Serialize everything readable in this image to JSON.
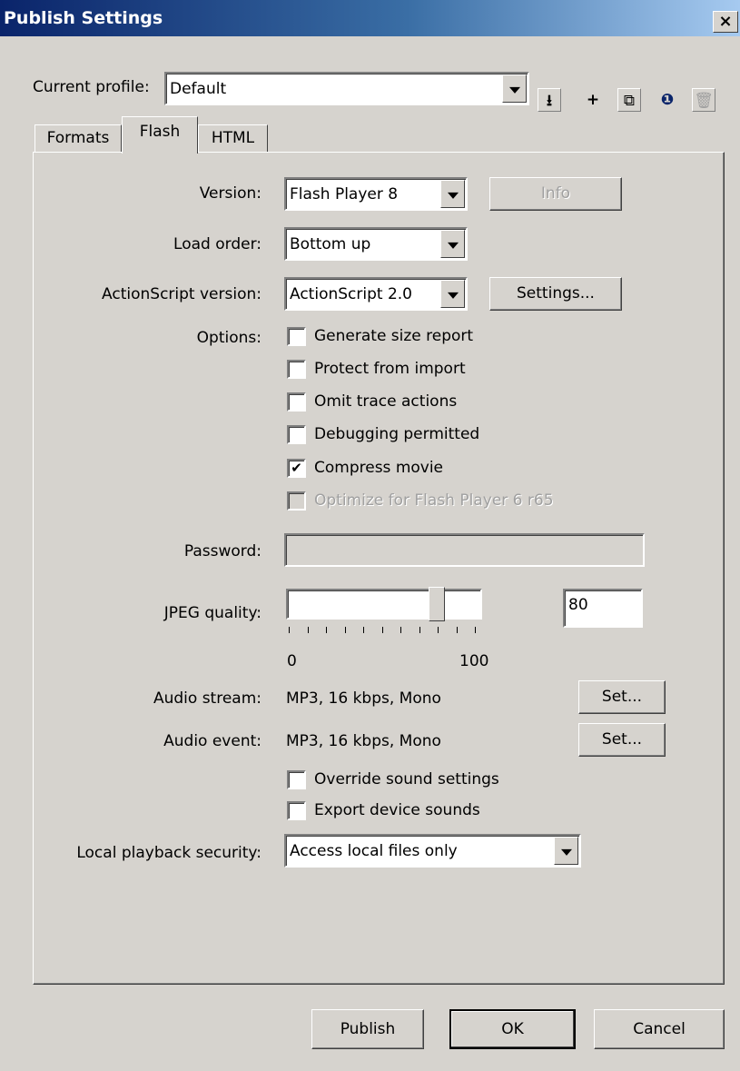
{
  "window": {
    "title": "Publish Settings",
    "close_glyph": "×"
  },
  "profile": {
    "label": "Current profile:",
    "value": "Default",
    "tools": [
      {
        "icon": "import-export-icon",
        "glyph": "⭳"
      },
      {
        "icon": "add-icon",
        "glyph": "+"
      },
      {
        "icon": "duplicate-icon",
        "glyph": "⧉"
      },
      {
        "icon": "info-icon",
        "glyph": "❶"
      },
      {
        "icon": "delete-icon",
        "glyph": "🗑"
      }
    ]
  },
  "tabs": [
    {
      "label": "Formats",
      "active": false
    },
    {
      "label": "Flash",
      "active": true
    },
    {
      "label": "HTML",
      "active": false
    }
  ],
  "flash": {
    "version": {
      "label": "Version:",
      "value": "Flash Player 8",
      "info_button": "Info"
    },
    "load_order": {
      "label": "Load order:",
      "value": "Bottom up"
    },
    "actionscript": {
      "label": "ActionScript version:",
      "value": "ActionScript 2.0",
      "settings_button": "Settings..."
    },
    "options": {
      "label": "Options:",
      "items": [
        {
          "label": "Generate size report",
          "checked": false,
          "enabled": true
        },
        {
          "label": "Protect from import",
          "checked": false,
          "enabled": true
        },
        {
          "label": "Omit trace actions",
          "checked": false,
          "enabled": true
        },
        {
          "label": "Debugging permitted",
          "checked": false,
          "enabled": true
        },
        {
          "label": "Compress movie",
          "checked": true,
          "enabled": true
        },
        {
          "label": "Optimize for Flash Player 6 r65",
          "checked": false,
          "enabled": false
        }
      ]
    },
    "password": {
      "label": "Password:",
      "value": ""
    },
    "jpeg": {
      "label": "JPEG quality:",
      "value": "80",
      "min_label": "0",
      "max_label": "100",
      "level": 80
    },
    "audio_stream": {
      "label": "Audio stream:",
      "value": "MP3, 16 kbps, Mono",
      "button": "Set..."
    },
    "audio_event": {
      "label": "Audio event:",
      "value": "MP3, 16 kbps, Mono",
      "button": "Set..."
    },
    "sound_options": [
      {
        "label": "Override sound settings",
        "checked": false
      },
      {
        "label": "Export device sounds",
        "checked": false
      }
    ],
    "local_playback": {
      "label": "Local playback security:",
      "value": "Access local files only"
    }
  },
  "footer": {
    "publish": "Publish",
    "ok": "OK",
    "cancel": "Cancel"
  },
  "check_glyph": "✔"
}
